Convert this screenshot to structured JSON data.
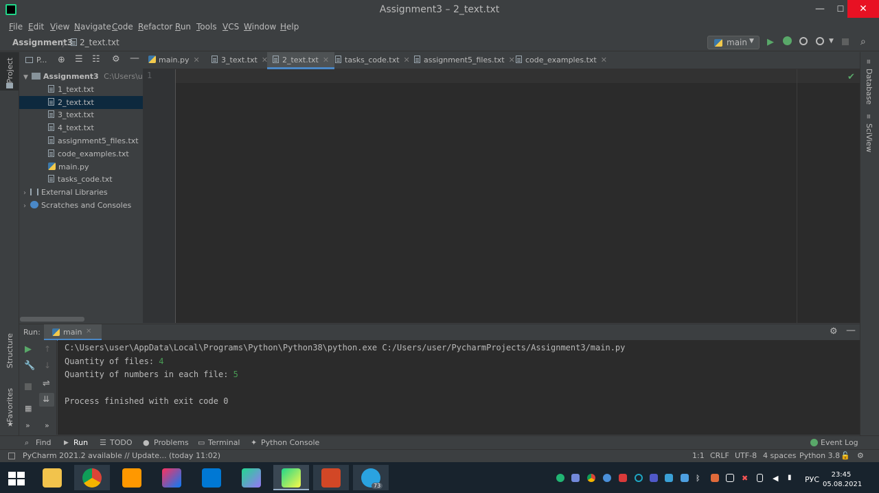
{
  "window": {
    "title": "Assignment3 – 2_text.txt",
    "minimize": "—",
    "maximize": "☐",
    "close": "✕"
  },
  "menu": [
    "File",
    "Edit",
    "View",
    "Navigate",
    "Code",
    "Refactor",
    "Run",
    "Tools",
    "VCS",
    "Window",
    "Help"
  ],
  "breadcrumb": {
    "project": "Assignment3",
    "file": "2_text.txt"
  },
  "run_config": "main",
  "project_panel": {
    "title": "P...",
    "root": {
      "name": "Assignment3",
      "path": "C:\\Users\\user"
    },
    "files": [
      "1_text.txt",
      "2_text.txt",
      "3_text.txt",
      "4_text.txt",
      "assignment5_files.txt",
      "code_examples.txt",
      "main.py",
      "tasks_code.txt"
    ],
    "selected": "2_text.txt",
    "external_libraries": "External Libraries",
    "scratches": "Scratches and Consoles"
  },
  "tabs": [
    "main.py",
    "3_text.txt",
    "2_text.txt",
    "tasks_code.txt",
    "assignment5_files.txt",
    "code_examples.txt"
  ],
  "active_tab": "2_text.txt",
  "editor": {
    "line_number": "1"
  },
  "left_stripe": {
    "project": "Project",
    "structure": "Structure",
    "favorites": "Favorites"
  },
  "right_stripe": {
    "database": "Database",
    "sciview": "SciView"
  },
  "run_panel": {
    "label": "Run:",
    "tab": "main",
    "console": {
      "command": "C:\\Users\\user\\AppData\\Local\\Programs\\Python\\Python38\\python.exe C:/Users/user/PycharmProjects/Assignment3/main.py",
      "files_label": "Quantity of files: ",
      "files_value": "4",
      "numbers_label": "Quantity of numbers in each file: ",
      "numbers_value": "5",
      "finished": "Process finished with exit code 0"
    }
  },
  "bottom_tools": [
    "Find",
    "Run",
    "TODO",
    "Problems",
    "Terminal",
    "Python Console"
  ],
  "event_log": "Event Log",
  "status": {
    "message": "PyCharm 2021.2 available // Update... (today 11:02)",
    "position": "1:1",
    "line_sep": "CRLF",
    "encoding": "UTF-8",
    "indent": "4 spaces",
    "interpreter": "Python 3.8"
  },
  "taskbar": {
    "language": "РУС",
    "time": "23:45",
    "date": "05.08.2021",
    "telegram_badge": "73"
  }
}
